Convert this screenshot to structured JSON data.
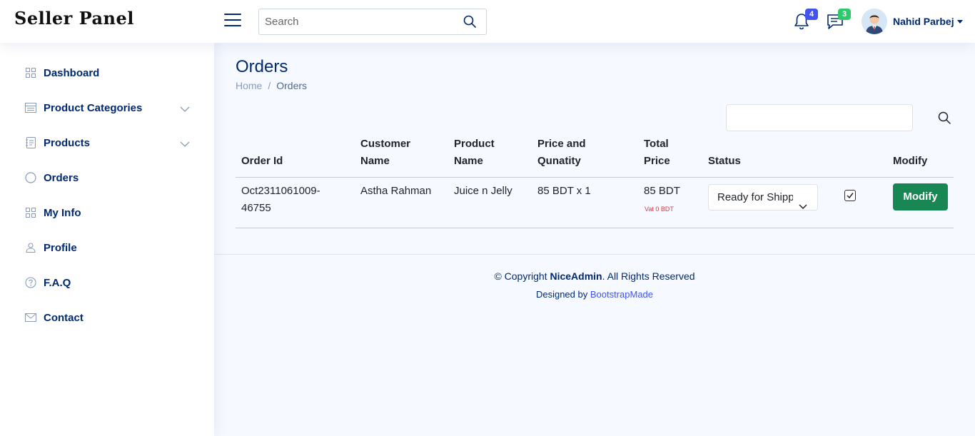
{
  "header": {
    "logo": "Seller Panel",
    "search_placeholder": "Search",
    "notifications_count": "4",
    "messages_count": "3",
    "user_name": "Nahid Parbej"
  },
  "sidebar": {
    "items": [
      {
        "label": "Dashboard",
        "icon": "grid-icon"
      },
      {
        "label": "Product Categories",
        "icon": "menu-list-icon",
        "expandable": true
      },
      {
        "label": "Products",
        "icon": "journal-text-icon",
        "expandable": true
      },
      {
        "label": "Orders",
        "icon": "circle-icon"
      },
      {
        "label": "My Info",
        "icon": "grid-icon"
      },
      {
        "label": "Profile",
        "icon": "person-icon"
      },
      {
        "label": "F.A.Q",
        "icon": "question-circle-icon"
      },
      {
        "label": "Contact",
        "icon": "envelope-icon"
      }
    ]
  },
  "page": {
    "title": "Orders",
    "breadcrumb": {
      "home": "Home",
      "separator": "/",
      "current": "Orders"
    }
  },
  "table": {
    "columns": [
      [
        "Order Id"
      ],
      [
        "Customer",
        "Name"
      ],
      [
        "Product",
        "Name"
      ],
      [
        "Price and",
        "Qunatity"
      ],
      [
        "Total",
        "Price"
      ],
      [
        "Status"
      ],
      [
        "Modify"
      ]
    ],
    "rows": [
      {
        "order_id_line1": "Oct2311061009-",
        "order_id_line2": "46755",
        "customer_name": "Astha Rahman",
        "product_name": "Juice n Jelly",
        "price_quantity": "85 BDT x 1",
        "total_price": "85 BDT",
        "vat": "Vat 0 BDT",
        "status": "Ready for Shipping",
        "checked": true,
        "modify_label": "Modify"
      }
    ]
  },
  "footer": {
    "copyright_prefix": "© Copyright",
    "brand": "NiceAdmin",
    "copyright_suffix": ". All Rights Reserved",
    "designed_by": "Designed by",
    "designer": "BootstrapMade"
  },
  "colors": {
    "primary": "#012970",
    "accent": "#4154f1",
    "success": "#198754",
    "badge_green": "#2eca6a",
    "danger": "#dc3545",
    "background": "#f6f9ff"
  }
}
